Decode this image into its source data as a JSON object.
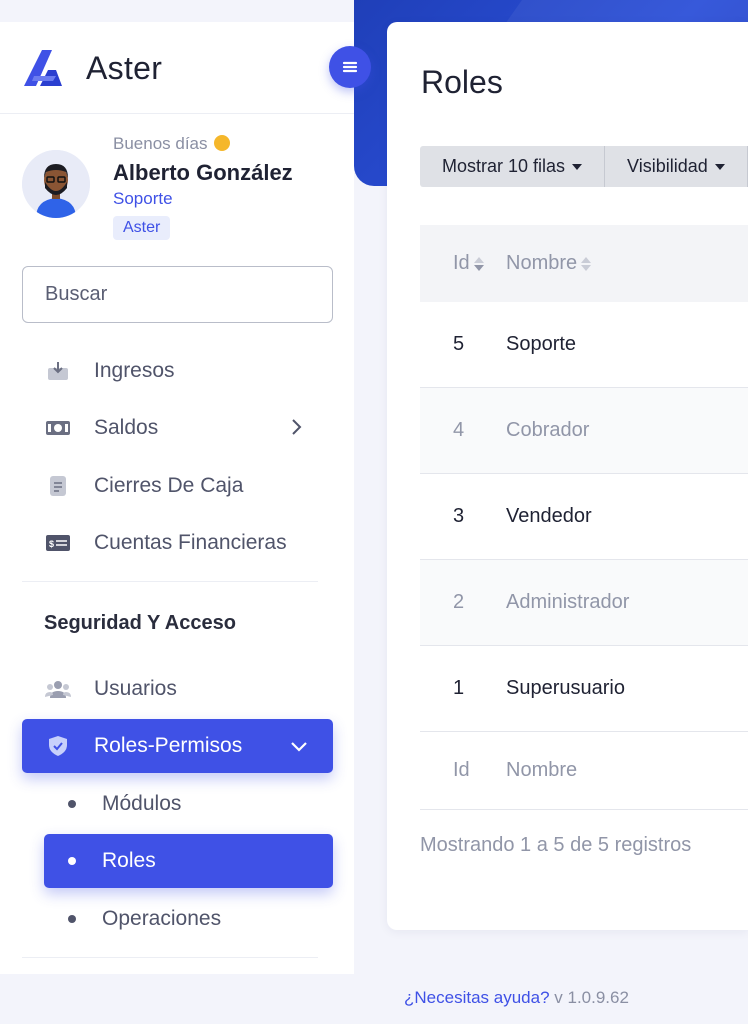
{
  "app": {
    "name": "Aster"
  },
  "profile": {
    "greeting": "Buenos días",
    "name": "Alberto González",
    "role": "Soporte",
    "badge": "Aster"
  },
  "search": {
    "placeholder": "Buscar"
  },
  "sidebar": {
    "items": [
      {
        "label": "Ingresos",
        "icon": "download-icon"
      },
      {
        "label": "Saldos",
        "icon": "money-icon"
      },
      {
        "label": "Cierres De Caja",
        "icon": "document-icon"
      },
      {
        "label": "Cuentas Financieras",
        "icon": "card-icon"
      }
    ],
    "section_title": "Seguridad Y Acceso",
    "security_items": [
      {
        "label": "Usuarios",
        "icon": "users-icon"
      },
      {
        "label": "Roles-Permisos",
        "icon": "shield-icon"
      }
    ],
    "sub_items": [
      {
        "label": "Módulos"
      },
      {
        "label": "Roles"
      },
      {
        "label": "Operaciones"
      }
    ]
  },
  "page": {
    "title": "Roles"
  },
  "toolbar": {
    "rows_label": "Mostrar 10 filas",
    "visibility_label": "Visibilidad"
  },
  "table": {
    "headers": {
      "id": "Id",
      "name": "Nombre"
    },
    "rows": [
      {
        "id": "5",
        "name": "Soporte"
      },
      {
        "id": "4",
        "name": "Cobrador"
      },
      {
        "id": "3",
        "name": "Vendedor"
      },
      {
        "id": "2",
        "name": "Administrador"
      },
      {
        "id": "1",
        "name": "Superusuario"
      }
    ],
    "footer": {
      "id": "Id",
      "name": "Nombre"
    },
    "info": "Mostrando 1 a 5 de 5 registros"
  },
  "footer": {
    "help_link": "¿Necesitas ayuda?",
    "version": "v 1.0.9.62"
  },
  "colors": {
    "accent": "#3f51e6",
    "band": "#2b4fd8"
  }
}
